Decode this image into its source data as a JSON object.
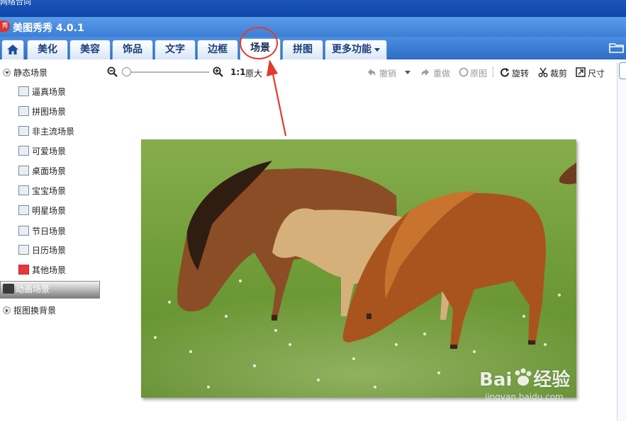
{
  "window": {
    "desktop_text": "网络合同",
    "app_badge": "秀",
    "title": "美图秀秀 4.0.1"
  },
  "tabs": [
    {
      "label": "",
      "icon": "home-icon"
    },
    {
      "label": "美化"
    },
    {
      "label": "美容"
    },
    {
      "label": "饰品"
    },
    {
      "label": "文字"
    },
    {
      "label": "边框"
    },
    {
      "label": "场景",
      "active": true
    },
    {
      "label": "拼图"
    },
    {
      "label": "更多功能"
    }
  ],
  "sidebar": {
    "static_group": "静态场景",
    "items": [
      {
        "label": "逼真场景"
      },
      {
        "label": "拼图场景"
      },
      {
        "label": "非主流场景"
      },
      {
        "label": "可爱场景"
      },
      {
        "label": "桌面场景"
      },
      {
        "label": "宝宝场景"
      },
      {
        "label": "明星场景"
      },
      {
        "label": "节日场景"
      },
      {
        "label": "日历场景"
      },
      {
        "label": "其他场景"
      }
    ],
    "animated_group": "动画场景",
    "cutout_group": "抠图换背景"
  },
  "toolbar": {
    "zoom_ratio": "1:1",
    "original_size": "原大",
    "undo": "撤销",
    "redo": "重做",
    "original": "原图",
    "rotate": "旋转",
    "crop": "裁剪",
    "size": "尺寸"
  },
  "watermark": {
    "brand": "Bai",
    "brand_cn": "经验",
    "url": "jingyan.baidu.com"
  },
  "colors": {
    "accent_blue": "#3c7fd6",
    "annotation_red": "#e23b2e",
    "grass_green": "#6a9a35"
  }
}
